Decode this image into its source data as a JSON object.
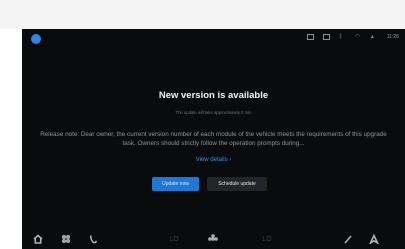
{
  "status_bar": {
    "time": "11:26",
    "icons": [
      "app-dot-icon",
      "cast-icon",
      "screen-icon",
      "bluetooth-icon",
      "wifi-icon",
      "signal-icon"
    ]
  },
  "dialog": {
    "title": "New version is available",
    "subtitle": "The update will take approximately 5 min",
    "note": "Release note: Dear owner, the current version number of each module of the vehicle meets the requirements of this upgrade task. Owners should strictly follow the operation prompts during...",
    "details_link": "View details ›",
    "primary_button": "Update now",
    "secondary_button": "Schedule update"
  },
  "dock": {
    "left_temp": "LO",
    "right_temp": "LO",
    "icons": [
      "home-icon",
      "apps-icon",
      "phone-icon",
      "fan-icon",
      "wiper-icon",
      "navigation-icon"
    ]
  },
  "colors": {
    "accent": "#1f78d6",
    "link": "#3b8fe8",
    "screen_background": "#0a0b0d"
  }
}
